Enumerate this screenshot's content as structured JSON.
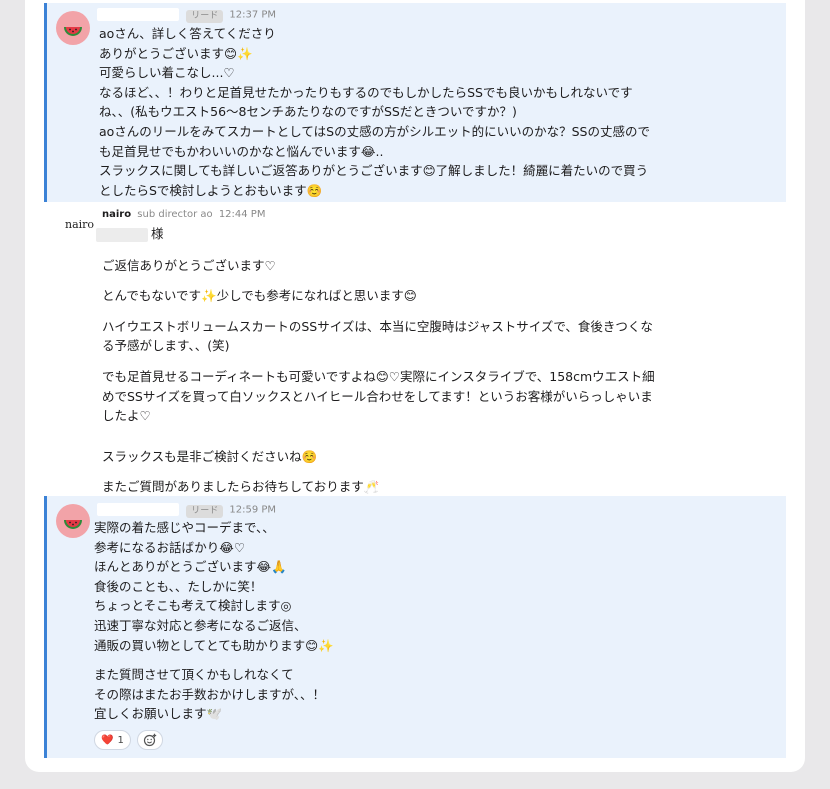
{
  "messages": [
    {
      "role": "リード",
      "time": "12:37 PM",
      "lines": [
        "aoさん、詳しく答えてくださり",
        "ありがとうございます😊✨",
        "可愛らしい着こなし...♡",
        "なるほど、、！わりと足首見せたかったりもするのでもしかしたらSSでも良いかもしれないです",
        "ね、、(私もウエスト56〜8センチあたりなのですがSSだときついですか？)",
        "aoさんのリールをみてスカートとしてはSの丈感の方がシルエット的にいいのかな？SSの丈感ので",
        "も足首見せでもかわいいのかなと悩んでいます😂..",
        "スラックスに関しても詳しいご返答ありがとうございます😊了解しました！綺麗に着たいので買う",
        "としたらSで検討しようとおもいます☺️"
      ]
    },
    {
      "workspace": "nairo",
      "sender": "nairo",
      "title": "sub director ao",
      "time": "12:44 PM",
      "salutation": "様",
      "paragraphs": [
        "ご返信ありがとうございます♡",
        "とんでもないです✨少しでも参考になればと思います😊",
        "ハイウエストボリュームスカートのSSサイズは、本当に空腹時はジャストサイズで、食後きつくな\nる予感がします、、(笑)",
        "でも足首見せるコーディネートも可愛いですよね😊♡実際にインスタライブで、158cmウエスト細\nめでSSサイズを買って白ソックスとハイヒール合わせをしてます！というお客様がいらっしゃいま\nしたよ♡",
        "スラックスも是非ご検討くださいね☺️",
        "またご質問がありましたらお待ちしております🥂"
      ]
    },
    {
      "role": "リード",
      "time": "12:59 PM",
      "block1": [
        "実際の着た感じやコーデまで、、",
        "参考になるお話ばかり😂♡",
        "ほんとありがとうございます😂🙏",
        "食後のことも、、たしかに笑！",
        "ちょっとそこも考えて検討します◎",
        "迅速丁寧な対応と参考になるご返信、",
        "通販の買い物としてとても助かります😊✨"
      ],
      "block2": [
        "また質問させて頂くかもしれなくて",
        "その際はまたお手数おかけしますが、、！",
        "宜しくお願いします🕊️"
      ],
      "reaction": {
        "emoji": "❤️",
        "count": "1"
      }
    }
  ],
  "icons": {
    "avatar": "watermelon-icon",
    "add_reaction": "add-reaction-icon"
  },
  "colors": {
    "highlight_bg": "#eaf2fc",
    "highlight_bar": "#3b82d6",
    "avatar_bg": "#f2a3a8"
  }
}
